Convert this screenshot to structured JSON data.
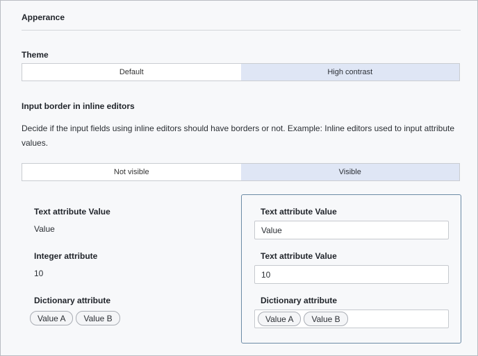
{
  "appearance": {
    "title": "Apperance"
  },
  "theme": {
    "label": "Theme",
    "options": [
      "Default",
      "High contrast"
    ],
    "selected": "Default"
  },
  "input_border": {
    "label": "Input border in inline editors",
    "description": "Decide if the input fields using inline editors should have borders or not. Example: Inline editors used to input attribute values.",
    "options": [
      "Not visible",
      "Visible"
    ],
    "selected": "Not visible"
  },
  "preview_left": {
    "text_label": "Text attribute Value",
    "text_value": "Value",
    "integer_label": "Integer attribute",
    "integer_value": "10",
    "dict_label": "Dictionary attribute",
    "dict_tags": [
      "Value A",
      "Value B"
    ]
  },
  "preview_right": {
    "text_label": "Text attribute Value",
    "text_value": "Value",
    "integer_label": "Text attribute Value",
    "integer_value": "10",
    "dict_label": "Dictionary attribute",
    "dict_tags": [
      "Value A",
      "Value B"
    ]
  },
  "colors": {
    "accent_unselected": "#dfe6f5",
    "preview_border": "#6b8aa5",
    "panel_background": "#f7f8fa"
  }
}
